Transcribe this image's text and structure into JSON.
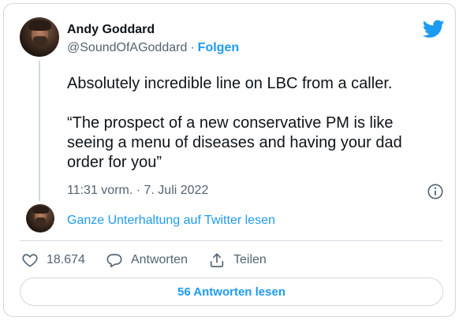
{
  "author": {
    "name": "Andy Goddard",
    "handle": "@SoundOfAGoddard",
    "separator": "·",
    "follow_label": "Folgen"
  },
  "tweet": {
    "lines": [
      "Absolutely incredible line on LBC from a caller.",
      "“The prospect of a new conservative PM is like seeing a menu of diseases and having your dad order for you”"
    ],
    "timestamp": "11:31 vorm. · 7. Juli 2022"
  },
  "conversation_link": "Ganze Unterhaltung auf Twitter lesen",
  "actions": {
    "likes": "18.674",
    "reply_label": "Antworten",
    "share_label": "Teilen"
  },
  "read_replies_label": "56 Antworten lesen",
  "colors": {
    "accent": "#1d9bf0",
    "text": "#0f1419",
    "secondary": "#536471",
    "border": "#cfd9de"
  },
  "icons": [
    "twitter-bird-icon",
    "info-icon",
    "heart-icon",
    "reply-bubble-icon",
    "share-icon"
  ]
}
